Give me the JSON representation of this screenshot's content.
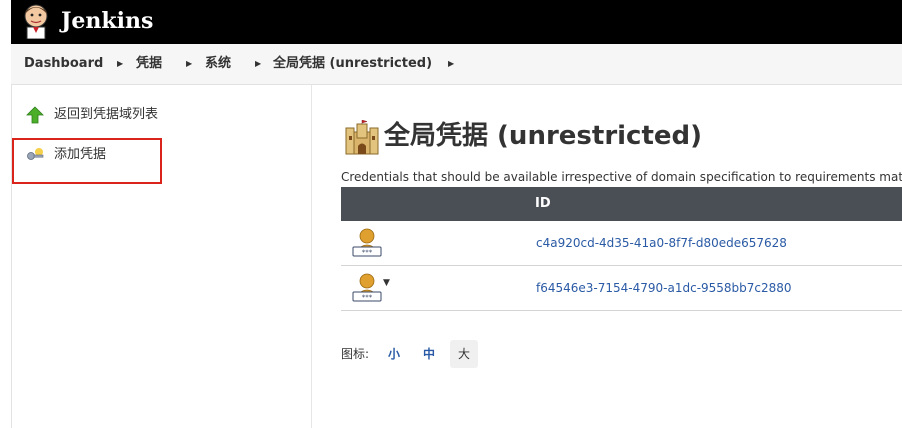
{
  "header": {
    "brand": "Jenkins",
    "logo_icon": "jenkins-butler-icon"
  },
  "breadcrumb": [
    {
      "label": "Dashboard"
    },
    {
      "label": "凭据"
    },
    {
      "label": "系统"
    },
    {
      "label": "全局凭据 (unrestricted)"
    }
  ],
  "sidebar": {
    "items": [
      {
        "label": "返回到凭据域列表",
        "icon": "green-up-arrow-icon"
      },
      {
        "label": "添加凭据",
        "icon": "key-icon"
      }
    ],
    "highlight_color": "#d9231b"
  },
  "main": {
    "title": "全局凭据 (unrestricted)",
    "title_icon": "castle-icon",
    "description": "Credentials that should be available irrespective of domain specification to requirements matching.",
    "table": {
      "columns": [
        "",
        "ID"
      ],
      "rows": [
        {
          "icon": "user-password-credential-icon",
          "id": "c4a920cd-4d35-41a0-8f7f-d80ede657628",
          "has_menu": false
        },
        {
          "icon": "user-password-credential-icon",
          "id": "f64546e3-7154-4790-a1dc-9558bb7c2880",
          "has_menu": true
        }
      ]
    },
    "icon_size": {
      "label": "图标:",
      "options": [
        "小",
        "中",
        "大"
      ],
      "selected": "大"
    }
  },
  "colors": {
    "header_bg": "#000000",
    "table_head_bg": "#4a4e55",
    "link": "#2a5aa5"
  }
}
